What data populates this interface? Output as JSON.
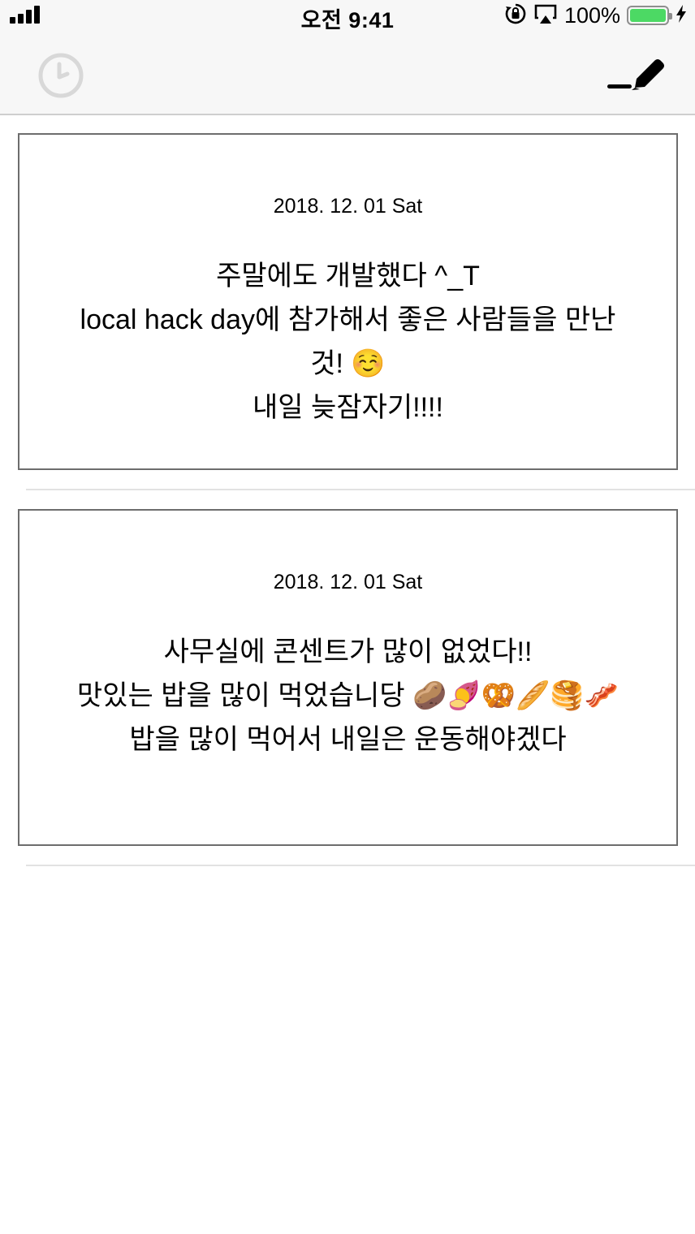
{
  "status_bar": {
    "time": "오전 9:41",
    "battery_percent": "100%",
    "battery_level": 1.0,
    "battery_color": "#4cd964",
    "icons": [
      "cellular-signal-icon",
      "orientation-lock-icon",
      "airplay-icon",
      "battery-icon",
      "charging-bolt-icon"
    ]
  },
  "nav_bar": {
    "left_icon": "clock-history-icon",
    "right_icon": "pen-compose-icon"
  },
  "entries": [
    {
      "date": "2018. 12. 01 Sat",
      "text": "주말에도 개발했다 ^_T\nlocal hack day에 참가해서 좋은 사람들을 만난것! ☺️\n내일 늦잠자기!!!!"
    },
    {
      "date": "2018. 12. 01 Sat",
      "text": "사무실에 콘센트가 많이 없었다!!\n맛있는 밥을 많이 먹었습니당 🥔🍠🥨🥖🥞🥓\n밥을 많이 먹어서 내일은 운동해야겠다"
    }
  ]
}
